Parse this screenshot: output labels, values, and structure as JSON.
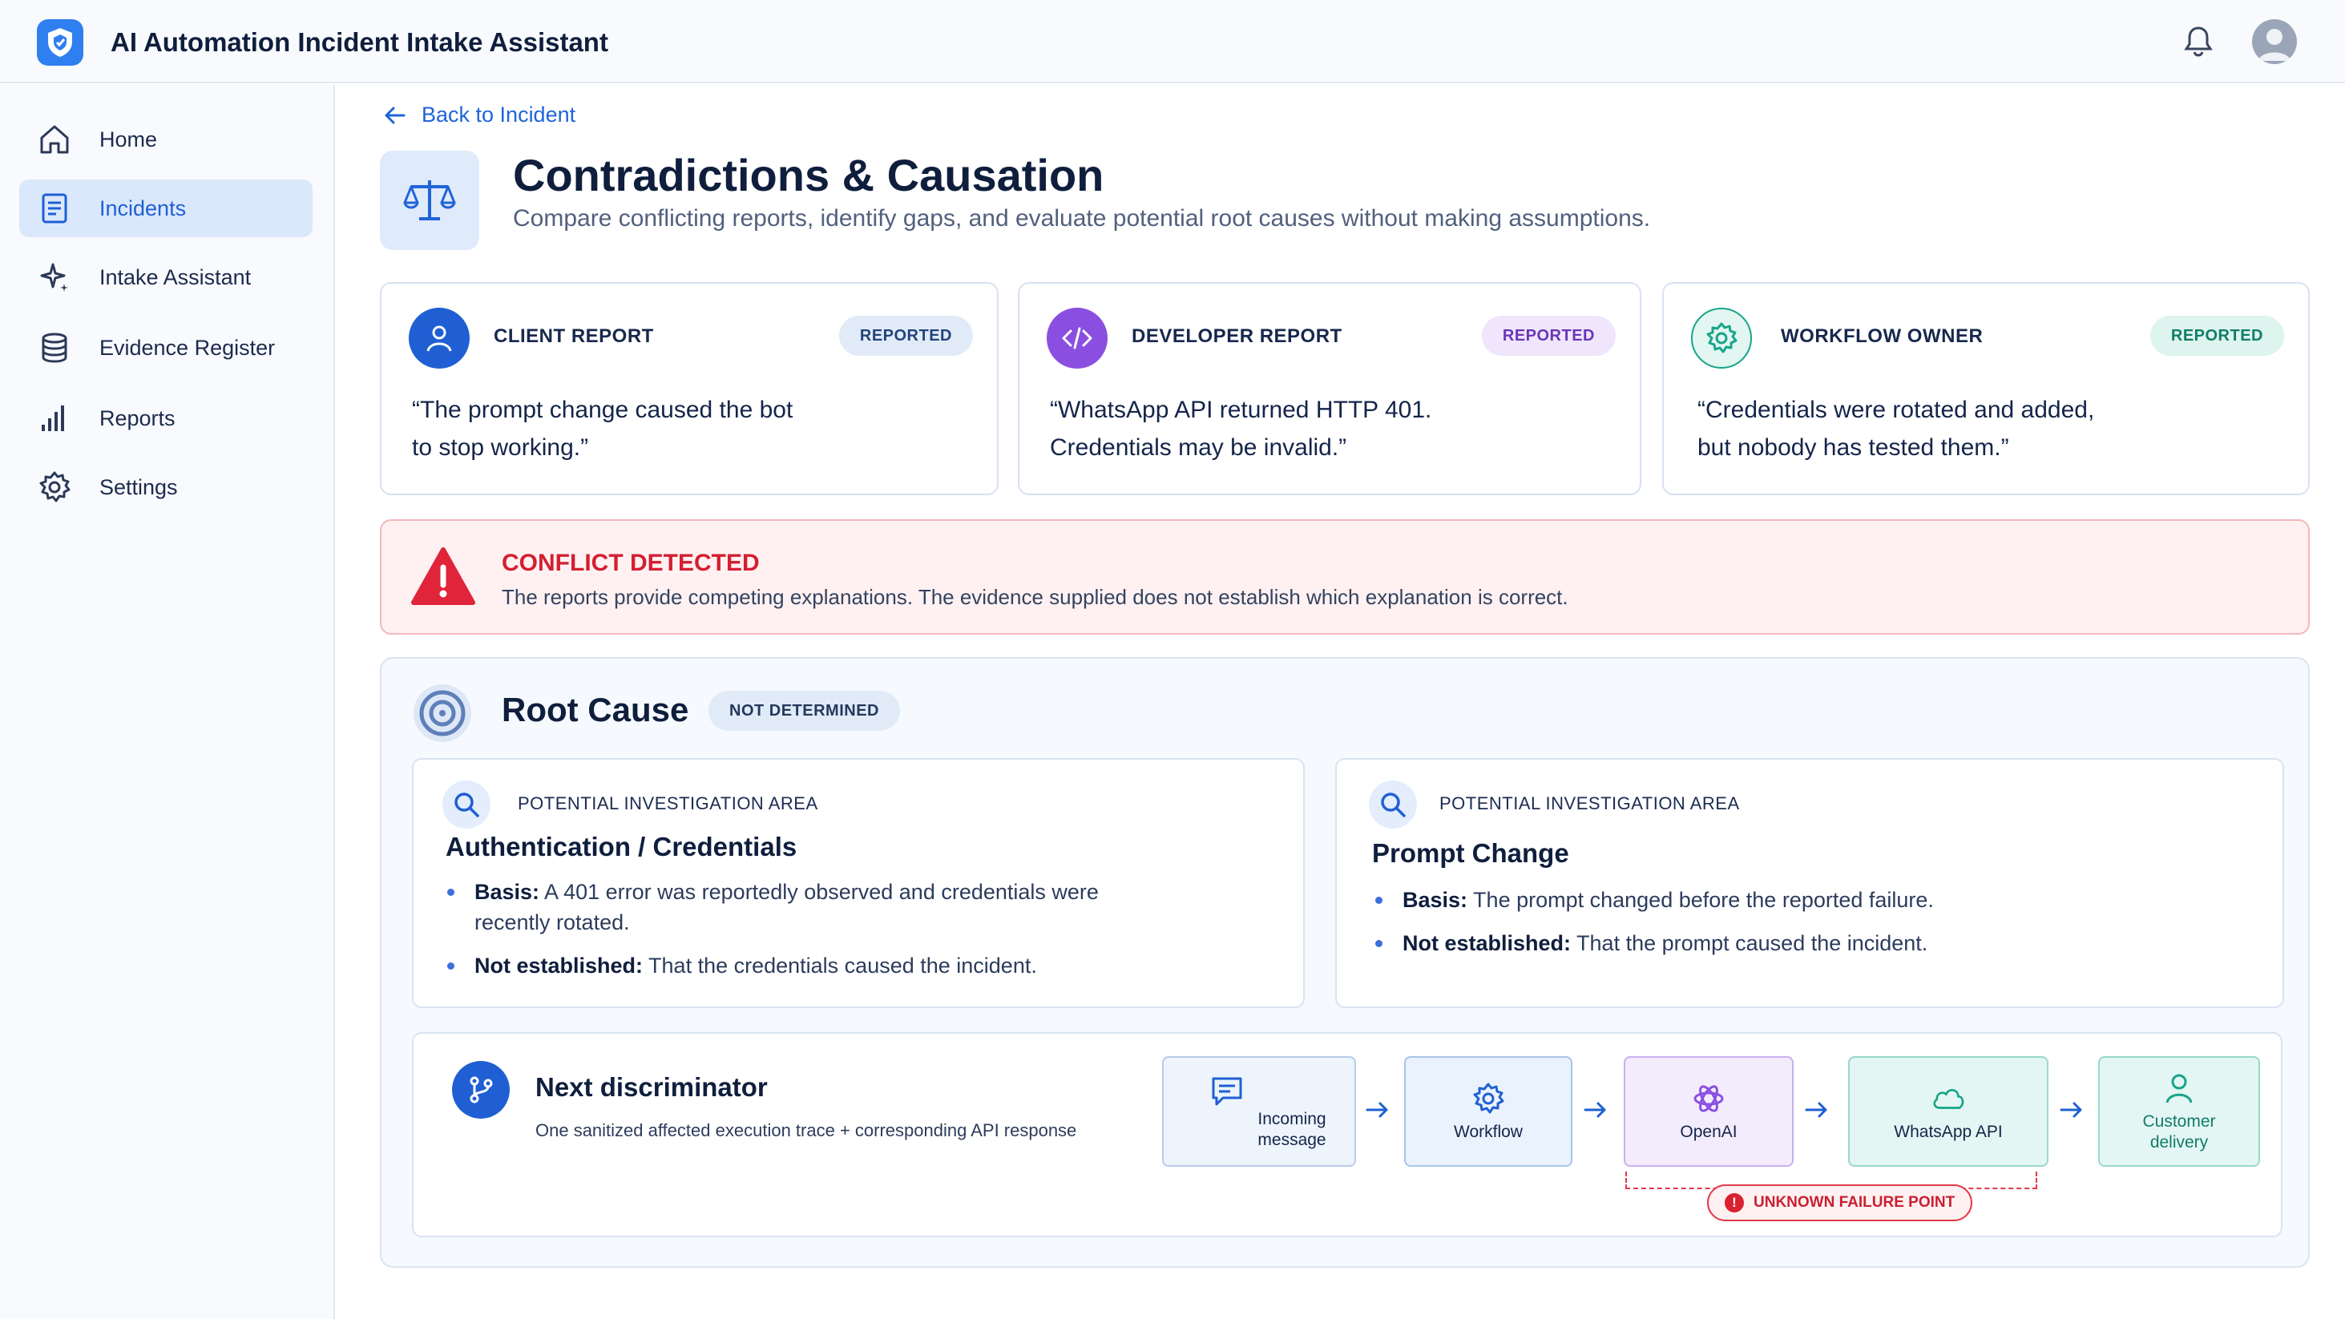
{
  "app": {
    "title": "AI Automation Incident Intake Assistant"
  },
  "sidebar": {
    "items": [
      {
        "label": "Home",
        "icon": "home-icon"
      },
      {
        "label": "Incidents",
        "icon": "document-icon",
        "active": true
      },
      {
        "label": "Intake Assistant",
        "icon": "sparkle-icon"
      },
      {
        "label": "Evidence Register",
        "icon": "database-icon"
      },
      {
        "label": "Reports",
        "icon": "bar-chart-icon"
      },
      {
        "label": "Settings",
        "icon": "gear-icon"
      }
    ]
  },
  "nav": {
    "back_label": "Back to Incident"
  },
  "page": {
    "title": "Contradictions & Causation",
    "subtitle": "Compare conflicting reports, identify gaps, and evaluate potential root causes without making assumptions."
  },
  "reports": [
    {
      "title": "CLIENT REPORT",
      "badge": "REPORTED",
      "quote_line1": "“The prompt change caused the bot",
      "quote_line2": "to stop working.”",
      "icon": "user-icon",
      "color": "#1f5fd3"
    },
    {
      "title": "DEVELOPER REPORT",
      "badge": "REPORTED",
      "quote_line1": "“WhatsApp API returned HTTP 401.",
      "quote_line2": "Credentials may be invalid.”",
      "icon": "code-icon",
      "color": "#8a4fe0"
    },
    {
      "title": "WORKFLOW OWNER",
      "badge": "REPORTED",
      "quote_line1": "“Credentials were rotated and added,",
      "quote_line2": "but nobody has tested them.”",
      "icon": "gear-icon",
      "color": "#17a58a"
    }
  ],
  "conflict": {
    "title": "CONFLICT DETECTED",
    "description": "The reports provide competing explanations. The evidence supplied does not establish which explanation is correct."
  },
  "root_cause": {
    "title": "Root Cause",
    "status": "NOT DETERMINED",
    "areas": [
      {
        "heading": "POTENTIAL INVESTIGATION AREA",
        "title": "Authentication / Credentials",
        "basis_label": "Basis:",
        "basis_line1": " A 401 error was reportedly observed and credentials were",
        "basis_line2": "recently rotated.",
        "not_label": "Not established:",
        "not_text": " That the credentials caused the incident."
      },
      {
        "heading": "POTENTIAL INVESTIGATION AREA",
        "title": "Prompt Change",
        "basis_label": "Basis:",
        "basis_text": " The prompt changed before the reported failure.",
        "not_label": "Not established:",
        "not_text": " That the prompt caused the incident."
      }
    ]
  },
  "discriminator": {
    "title": "Next discriminator",
    "description": "One sanitized affected execution trace + corresponding API response",
    "flow": [
      {
        "line1": "Incoming",
        "line2": "message",
        "icon": "chat-icon"
      },
      {
        "line1": "Workflow",
        "icon": "gear-icon"
      },
      {
        "line1": "OpenAI",
        "icon": "openai-icon"
      },
      {
        "line1": "WhatsApp API",
        "icon": "cloud-icon"
      },
      {
        "line1": "Customer",
        "line2": "delivery",
        "icon": "user-icon"
      }
    ],
    "unknown_label": "UNKNOWN FAILURE POINT"
  },
  "colors": {
    "accent": "#1f64d8",
    "danger": "#d41f31",
    "purple": "#8a4fe0",
    "teal": "#17a58a"
  }
}
